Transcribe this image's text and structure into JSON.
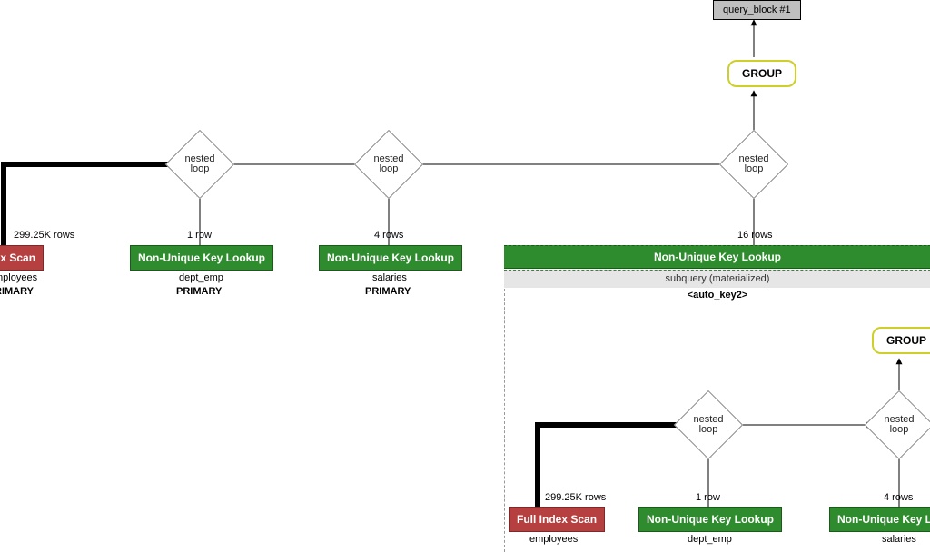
{
  "query_block_label": "query_block #1",
  "group_label": "GROUP",
  "nested_loop_label": "nested\nloop",
  "edge_rows": {
    "emp_top": "299.25K rows",
    "deptemp_top": "1 row",
    "sal_top": "4 rows",
    "subq_top": "16 rows",
    "emp_sub": "299.25K rows",
    "deptemp_sub": "1 row",
    "sal_sub": "4 rows"
  },
  "ops": {
    "full_index_scan": "Full Index Scan",
    "index_scan_clip": "ndex Scan",
    "non_unique_lookup": "Non-Unique Key Lookup",
    "non_unique_lookup_clip": "Non-Unique Key Loo"
  },
  "tables": {
    "employees": "employees",
    "employees_clip": "mployees",
    "dept_emp": "dept_emp",
    "dept_emp_trunc": "dept_emp",
    "salaries": "salaries"
  },
  "keys": {
    "primary": "PRIMARY",
    "primary_clip": "RIMARY",
    "auto_key2": "<auto_key2>"
  },
  "subquery_label": "subquery (materialized)"
}
